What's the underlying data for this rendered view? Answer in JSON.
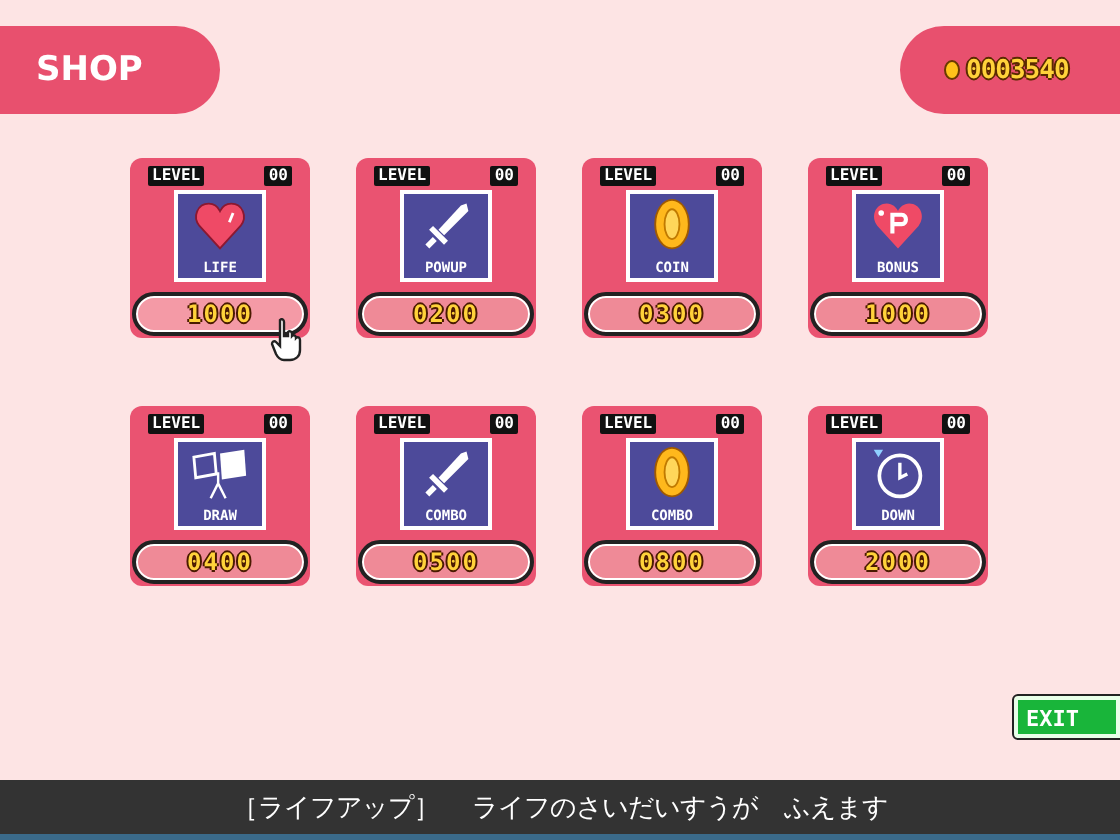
{
  "header": {
    "title": "SHOP"
  },
  "coins": {
    "amount": "0003540"
  },
  "items": [
    {
      "level_label": "LEVEL",
      "level_value": "00",
      "kind": "heart",
      "name": "LIFE",
      "price": "1000",
      "selected": true
    },
    {
      "level_label": "LEVEL",
      "level_value": "00",
      "kind": "sword",
      "name": "POWUP",
      "price": "0200",
      "selected": false
    },
    {
      "level_label": "LEVEL",
      "level_value": "00",
      "kind": "coin",
      "name": "COIN",
      "price": "0300",
      "selected": false
    },
    {
      "level_label": "LEVEL",
      "level_value": "00",
      "kind": "bonus",
      "name": "BONUS",
      "price": "1000",
      "selected": false
    },
    {
      "level_label": "LEVEL",
      "level_value": "00",
      "kind": "draw",
      "name": "DRAW",
      "price": "0400",
      "selected": false
    },
    {
      "level_label": "LEVEL",
      "level_value": "00",
      "kind": "sword",
      "name": "COMBO",
      "price": "0500",
      "selected": false
    },
    {
      "level_label": "LEVEL",
      "level_value": "00",
      "kind": "coin",
      "name": "COMBO",
      "price": "0800",
      "selected": false
    },
    {
      "level_label": "LEVEL",
      "level_value": "00",
      "kind": "clock",
      "name": "DOWN",
      "price": "2000",
      "selected": false
    }
  ],
  "exit_button": {
    "label": "EXIT"
  },
  "message": {
    "tag": "［ライフアップ］",
    "text": "ライフのさいだいすうが　ふえます"
  }
}
